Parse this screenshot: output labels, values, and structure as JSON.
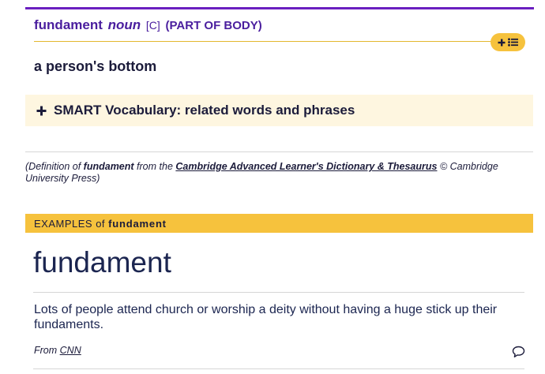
{
  "entry": {
    "headword": "fundament",
    "pos": "noun",
    "grammar": "[C]",
    "guideword": "(PART OF BODY)",
    "definition": "a person's bottom"
  },
  "smart_vocab": {
    "plus": "+",
    "label": "SMART Vocabulary: related words and phrases"
  },
  "source": {
    "prefix": "(Definition of",
    "word": "fundament",
    "middle": "from the",
    "dictionary": "Cambridge Advanced Learner's Dictionary & Thesaurus",
    "suffix": "© Cambridge University Press)"
  },
  "examples": {
    "label": "EXAMPLES of",
    "word": "fundament",
    "title": "fundament",
    "items": [
      {
        "text": "Lots of people attend church or worship a deity without having a huge stick up their fundaments.",
        "from_label": "From",
        "source": "CNN"
      }
    ]
  },
  "colors": {
    "purple_accent": "#6a1fc0",
    "headword_purple": "#4a1e9e",
    "yellow": "#f6c23d",
    "pale_yellow": "#fef6e0",
    "navy_text": "#1b2550"
  },
  "icons": {
    "pill_button": [
      "plus-icon",
      "list-icon"
    ],
    "smart_vocab": "plus-icon",
    "example_feedback": "speech-bubble-icon"
  }
}
